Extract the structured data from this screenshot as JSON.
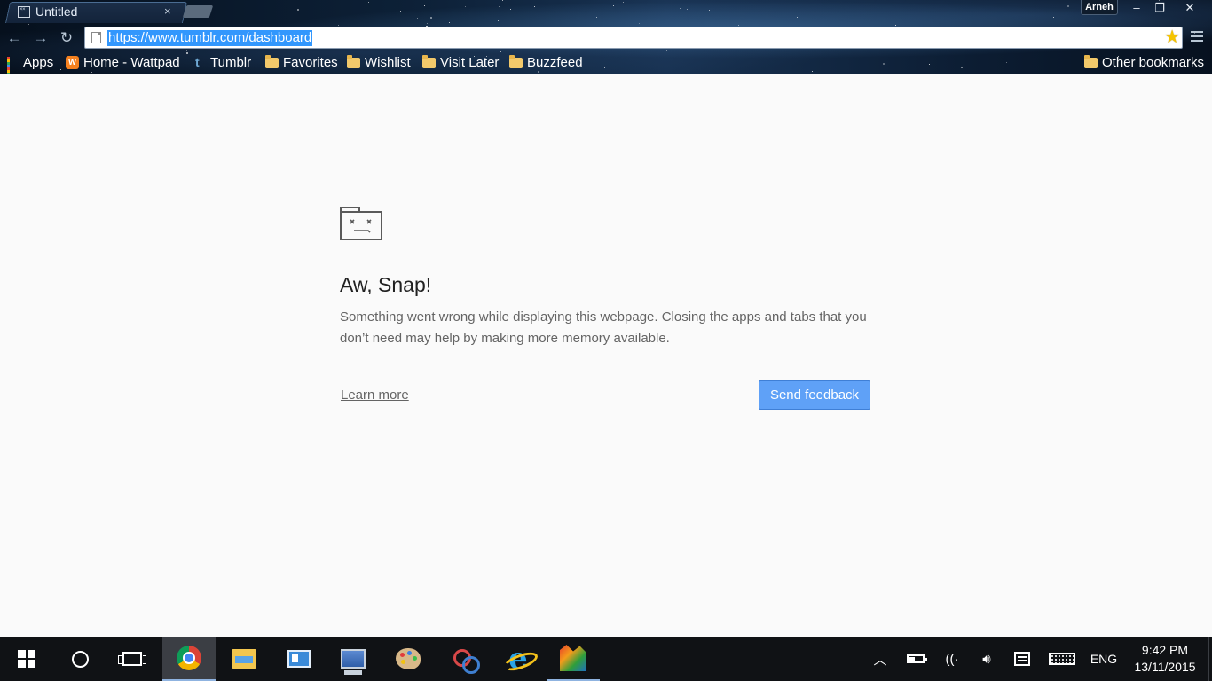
{
  "browser": {
    "tab": {
      "title": "Untitled",
      "close_glyph": "×"
    },
    "window_controls": {
      "profile_label": "Arneh",
      "minimize_glyph": "–",
      "maximize_glyph": "❐",
      "close_glyph": "✕"
    },
    "toolbar": {
      "back_glyph": "←",
      "forward_glyph": "→",
      "reload_glyph": "↻",
      "url": "https://www.tumblr.com/dashboard",
      "bookmark_star_glyph": "★"
    },
    "bookmarks": [
      {
        "label": "Apps",
        "icon": "apps-grid-icon"
      },
      {
        "label": "Home - Wattpad",
        "icon": "wattpad-icon",
        "icon_text": "w"
      },
      {
        "label": "Tumblr",
        "icon": "tumblr-icon",
        "icon_text": "t"
      },
      {
        "label": "Favorites",
        "icon": "folder-icon"
      },
      {
        "label": "Wishlist",
        "icon": "folder-icon"
      },
      {
        "label": "Visit Later",
        "icon": "folder-icon"
      },
      {
        "label": "Buzzfeed",
        "icon": "folder-icon"
      }
    ],
    "other_bookmarks": {
      "label": "Other bookmarks",
      "icon": "folder-icon"
    }
  },
  "error_page": {
    "title": "Aw, Snap!",
    "message": "Something went wrong while displaying this webpage. Closing the apps and tabs that you don’t need may help by making more memory available.",
    "learn_more": "Learn more",
    "send_feedback": "Send feedback"
  },
  "taskbar": {
    "apps": [
      {
        "name": "chrome",
        "icon": "chrome-icon",
        "active": true
      },
      {
        "name": "file-explorer",
        "icon": "folder-icon"
      },
      {
        "name": "contacts",
        "icon": "contact-card-icon"
      },
      {
        "name": "this-pc",
        "icon": "computer-icon"
      },
      {
        "name": "paint",
        "icon": "paint-palette-icon"
      },
      {
        "name": "snipping-tool",
        "icon": "scissors-icon"
      },
      {
        "name": "internet-explorer",
        "icon": "ie-icon"
      },
      {
        "name": "avg",
        "icon": "avg-icon",
        "open": true
      }
    ],
    "tray": {
      "chevron_glyph": "︿",
      "wifi_glyph": "((·",
      "volume_glyph": "🔊︎",
      "language": "ENG",
      "time": "9:42 PM",
      "date": "13/11/2015"
    }
  },
  "colors": {
    "url_highlight": "#3297fd",
    "send_feedback_bg": "#5fa1f7",
    "taskbar_bg": "#101215",
    "page_bg": "#fafafa"
  }
}
